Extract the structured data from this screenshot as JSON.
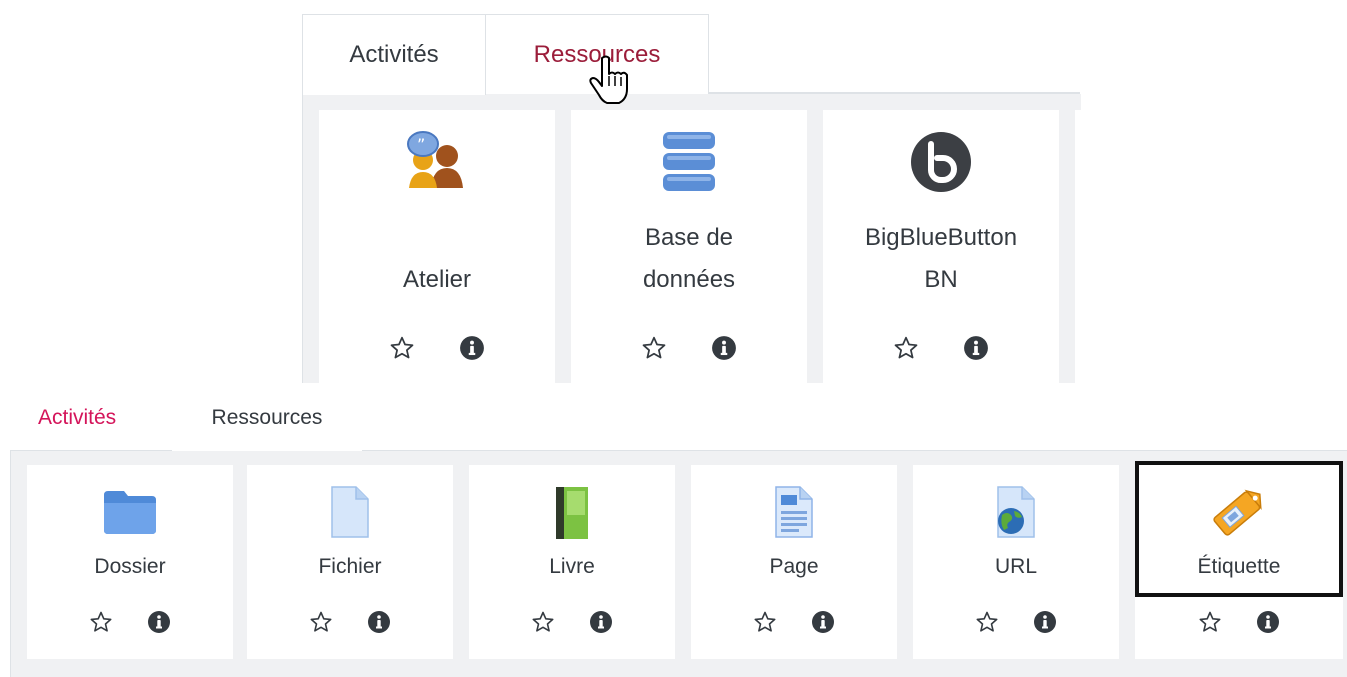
{
  "top": {
    "tabs": [
      {
        "label": "Activités",
        "active": true
      },
      {
        "label": "Ressources",
        "active": false
      }
    ],
    "cards": [
      {
        "label_line1": "Atelier",
        "label_line2": "",
        "icon": "workshop-icon"
      },
      {
        "label_line1": "Base de",
        "label_line2": "données",
        "icon": "database-icon"
      },
      {
        "label_line1": "BigBlueButton",
        "label_line2": "BN",
        "icon": "bigbluebutton-icon"
      }
    ]
  },
  "bottom": {
    "tabs": [
      {
        "label": "Activités",
        "active": false
      },
      {
        "label": "Ressources",
        "active": true
      }
    ],
    "cards": [
      {
        "label": "Dossier",
        "icon": "folder-icon"
      },
      {
        "label": "Fichier",
        "icon": "file-icon"
      },
      {
        "label": "Livre",
        "icon": "book-icon"
      },
      {
        "label": "Page",
        "icon": "page-icon"
      },
      {
        "label": "URL",
        "icon": "url-icon"
      },
      {
        "label": "Étiquette",
        "icon": "label-tag-icon",
        "highlighted": true
      }
    ]
  },
  "colors": {
    "accent_top": "#9b1d3a",
    "accent_bottom": "#d4145a",
    "panel_bg": "#f0f1f3",
    "highlight_border": "#111111"
  }
}
